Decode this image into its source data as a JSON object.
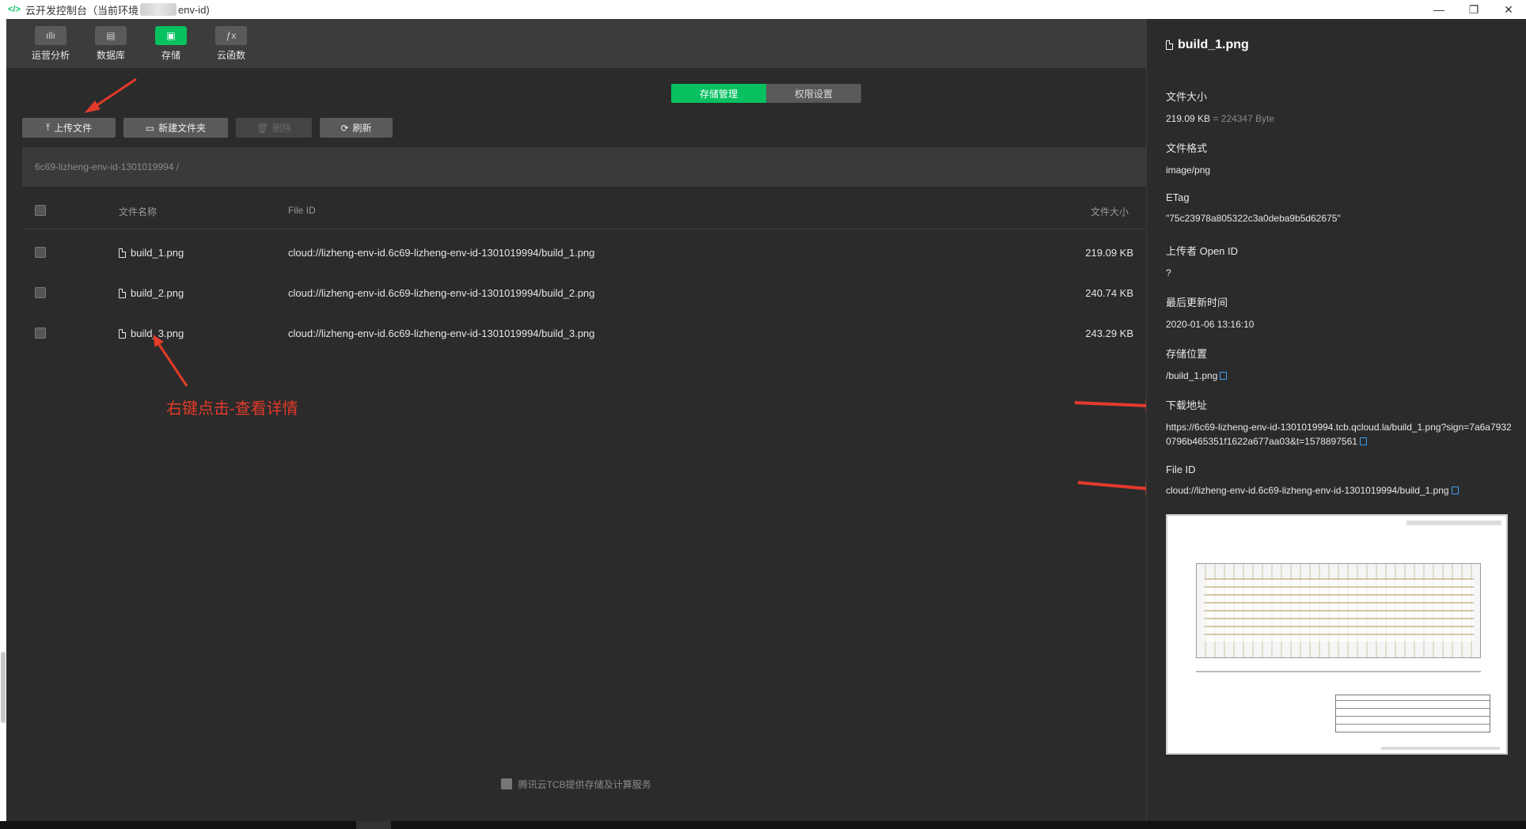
{
  "titlebar": {
    "title_prefix": "云开发控制台（当前环境",
    "title_suffix": "env-id)",
    "minimize": "—",
    "restore": "❐",
    "close": "✕"
  },
  "toolbar": {
    "items": [
      {
        "label": "运营分析",
        "icon": "chart-icon",
        "glyph": "ıllı"
      },
      {
        "label": "数据库",
        "icon": "database-icon",
        "glyph": "▤"
      },
      {
        "label": "存储",
        "icon": "storage-icon",
        "glyph": "▣"
      },
      {
        "label": "云函数",
        "icon": "function-icon",
        "glyph": "ƒx"
      }
    ],
    "active": "存储"
  },
  "tabs": {
    "storage_manage": "存储管理",
    "permission_settings": "权限设置"
  },
  "actions": {
    "upload": "上传文件",
    "new_folder": "新建文件夹",
    "delete": "删除",
    "refresh": "刷新"
  },
  "breadcrumb": "6c69-lizheng-env-id-1301019994 /",
  "table": {
    "headers": {
      "name": "文件名称",
      "file_id": "File ID",
      "size": "文件大小"
    },
    "rows": [
      {
        "name": "build_1.png",
        "file_id": "cloud://lizheng-env-id.6c69-lizheng-env-id-1301019994/build_1.png",
        "size": "219.09 KB"
      },
      {
        "name": "build_2.png",
        "file_id": "cloud://lizheng-env-id.6c69-lizheng-env-id-1301019994/build_2.png",
        "size": "240.74 KB"
      },
      {
        "name": "build_3.png",
        "file_id": "cloud://lizheng-env-id.6c69-lizheng-env-id-1301019994/build_3.png",
        "size": "243.29 KB"
      }
    ]
  },
  "annotation": "右键点击-查看详情",
  "footer": "腾讯云TCB提供存储及计算服务",
  "panel": {
    "title": "build_1.png",
    "fields": {
      "size_label": "文件大小",
      "size_value": "219.09 KB",
      "size_bytes": "= 224347 Byte",
      "format_label": "文件格式",
      "format_value": "image/png",
      "etag_label": "ETag",
      "etag_value": "\"75c23978a805322c3a0deba9b5d62675\"",
      "uploader_label": "上传者 Open ID",
      "uploader_value": "?",
      "updated_label": "最后更新时间",
      "updated_value": "2020-01-06 13:16:10",
      "location_label": "存储位置",
      "location_value": "/build_1.png",
      "download_label": "下载地址",
      "download_value": "https://6c69-lizheng-env-id-1301019994.tcb.qcloud.la/build_1.png?sign=7a6a79320796b465351f1622a677aa03&t=1578897561",
      "fileid_label": "File ID",
      "fileid_value": "cloud://lizheng-env-id.6c69-lizheng-env-id-1301019994/build_1.png"
    }
  },
  "colors": {
    "accent": "#07c160",
    "annotation": "#e23a2a",
    "link": "#3ea0ff"
  }
}
